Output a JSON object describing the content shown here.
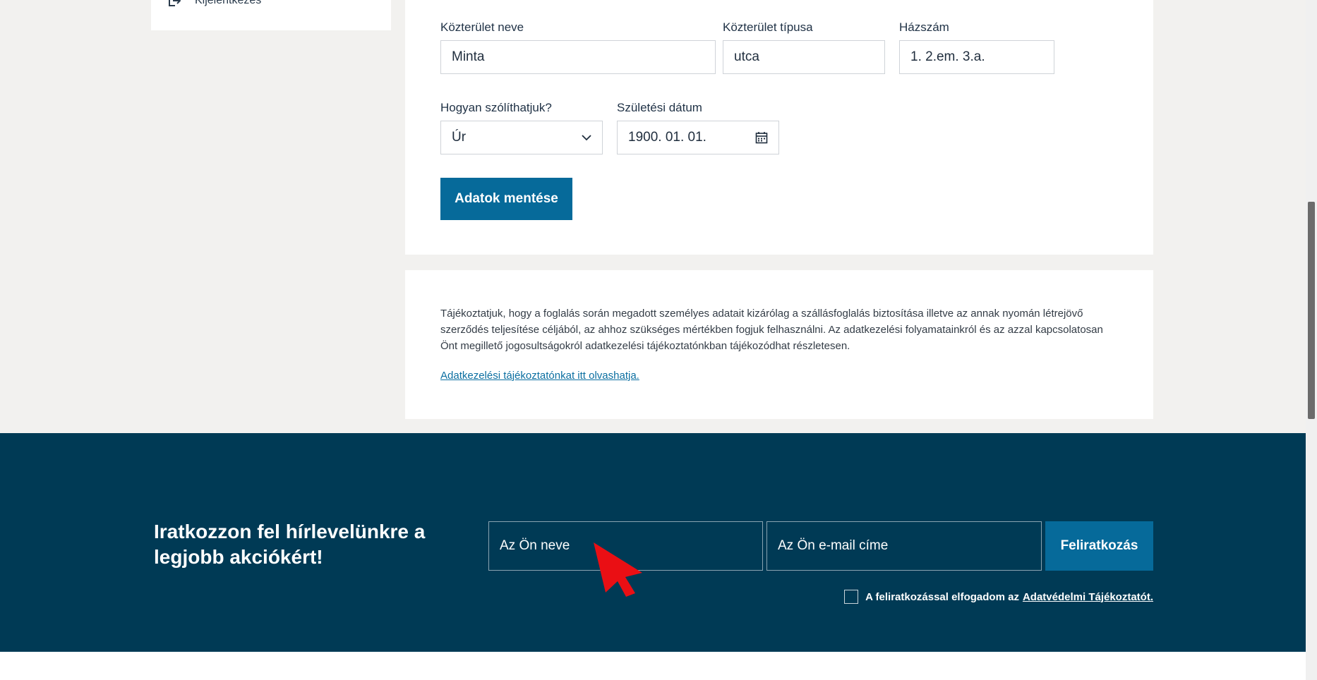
{
  "sidebar": {
    "logout_label": "Kijelentkezés"
  },
  "form": {
    "street_name": {
      "label": "Közterület neve",
      "value": "Minta"
    },
    "street_type": {
      "label": "Közterület típusa",
      "value": "utca"
    },
    "house_number": {
      "label": "Házszám",
      "value": "1. 2.em. 3.a."
    },
    "salutation": {
      "label": "Hogyan szólíthatjuk?",
      "value": "Úr"
    },
    "birth_date": {
      "label": "Születési dátum",
      "value": "1900. 01. 01."
    },
    "save_label": "Adatok mentése"
  },
  "info": {
    "text": "Tájékoztatjuk, hogy a foglalás során megadott személyes adatait kizárólag a szállásfoglalás biztosítása illetve az annak nyomán létrejövő szerződés teljesítése céljából, az ahhoz szükséges mértékben fogjuk felhasználni. Az adatkezelési folyamatainkról és az azzal kapcsolatosan Önt megillető jogosultságokról adatkezelési tájékoztatónkban tájékozódhat részletesen.",
    "link": "Adatkezelési tájékoztatónkat itt olvashatja."
  },
  "newsletter": {
    "title": "Iratkozzon fel hírlevelünkre a legjobb akciókért!",
    "name_placeholder": "Az Ön neve",
    "email_placeholder": "Az Ön e-mail címe",
    "submit_label": "Feliratkozás",
    "consent_text": "A feliratkozással elfogadom az",
    "consent_link": "Adatvédelmi Tájékoztatót."
  },
  "colors": {
    "brand": "#066a9a",
    "footer_bg": "#003a55",
    "page_bg": "#f2f1ef"
  }
}
